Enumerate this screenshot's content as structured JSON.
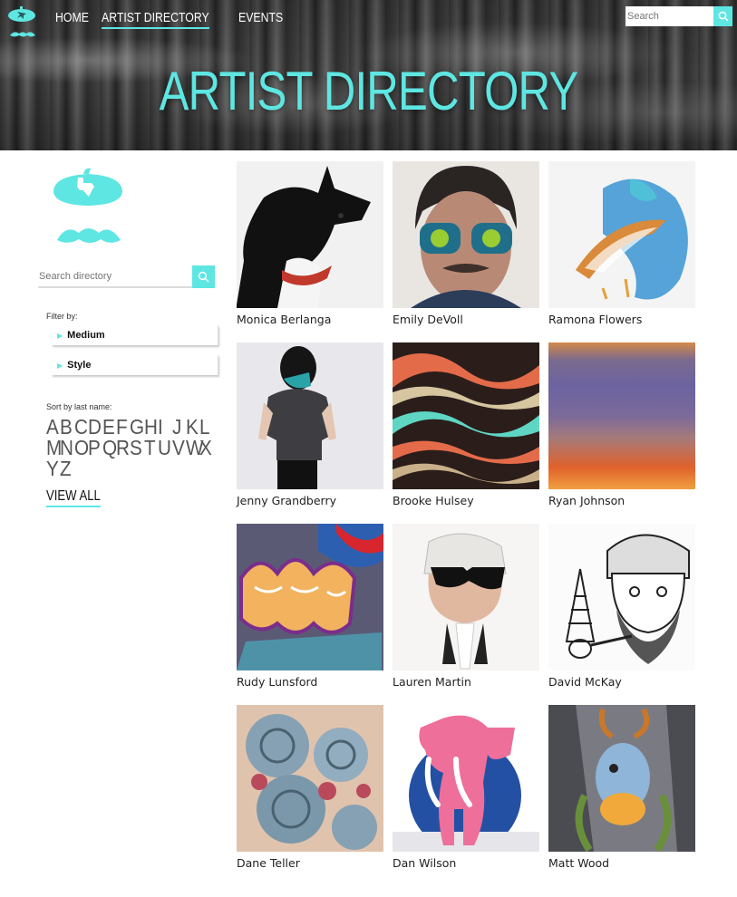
{
  "nav": {
    "items": [
      {
        "label": "HOME",
        "active": false
      },
      {
        "label": "ARTIST DIRECTORY",
        "active": true
      },
      {
        "label": "EVENTS",
        "active": false
      }
    ],
    "search_placeholder": "Search"
  },
  "hero": {
    "title": "ARTIST DIRECTORY"
  },
  "sidebar": {
    "search_placeholder": "Search directory",
    "filter_label": "Filter by:",
    "filters": [
      "Medium",
      "Style"
    ],
    "sort_label": "Sort by last name:",
    "letters": [
      "A",
      "B",
      "C",
      "D",
      "E",
      "F",
      "G",
      "H",
      "I",
      "J",
      "K",
      "L",
      "M",
      "N",
      "O",
      "P",
      "Q",
      "R",
      "S",
      "T",
      "U",
      "V",
      "W",
      "X",
      "Y",
      "Z"
    ],
    "view_all": "VIEW ALL"
  },
  "artists": [
    {
      "name": "Monica Berlanga",
      "image": "black dog with red collar"
    },
    {
      "name": "Emily DeVoll",
      "image": "portrait with reflective sunglasses"
    },
    {
      "name": "Ramona Flowers",
      "image": "watercolor dolphin"
    },
    {
      "name": "Jenny Grandberry",
      "image": "girl with teal hair"
    },
    {
      "name": "Brooke Hulsey",
      "image": "marbled abstract"
    },
    {
      "name": "Ryan Johnson",
      "image": "color field gradient"
    },
    {
      "name": "Rudy Lunsford",
      "image": "graffiti lettering"
    },
    {
      "name": "Lauren Martin",
      "image": "man with dark sunglasses"
    },
    {
      "name": "David McKay",
      "image": "bearded man sketch"
    },
    {
      "name": "Dane Teller",
      "image": "dotwork roses"
    },
    {
      "name": "Dan Wilson",
      "image": "pink elephant"
    },
    {
      "name": "Matt Wood",
      "image": "jackalope tattoo"
    }
  ],
  "colors": {
    "accent": "#5ee6e2"
  },
  "icons": {
    "search": "search-icon",
    "logo": "beret-mustache-logo-icon",
    "filter_arrow": "triangle-right-icon"
  }
}
